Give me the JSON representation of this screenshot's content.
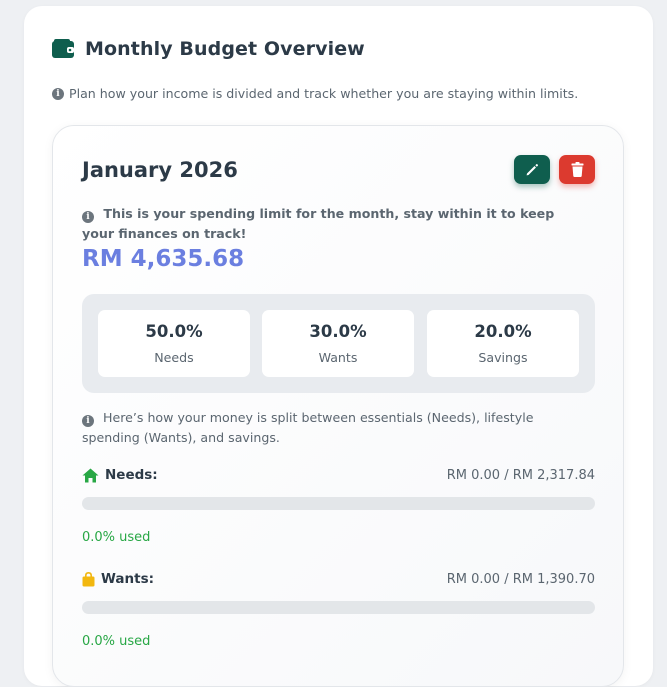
{
  "header": {
    "title": "Monthly Budget Overview",
    "info": "Plan how your income is divided and track whether you are staying within limits."
  },
  "budget": {
    "month": "January 2026",
    "limit_info": "This is your spending limit for the month, stay within it to keep your finances on track!",
    "amount": "RM 4,635.68",
    "split": [
      {
        "percent": "50.0%",
        "label": "Needs"
      },
      {
        "percent": "30.0%",
        "label": "Wants"
      },
      {
        "percent": "20.0%",
        "label": "Savings"
      }
    ],
    "split_info": "Here’s how your money is split between essentials (Needs), lifestyle spending (Wants), and savings.",
    "categories": [
      {
        "name": "Needs:",
        "amount": "RM 0.00 / RM 2,317.84",
        "used": "0.0% used",
        "used_fraction": 0,
        "icon": "home-icon"
      },
      {
        "name": "Wants:",
        "amount": "RM 0.00 / RM 1,390.70",
        "used": "0.0% used",
        "used_fraction": 0,
        "icon": "shopping-bag-icon"
      }
    ]
  },
  "colors": {
    "accent": "#6b7fe0",
    "edit": "#0f5e4e",
    "delete": "#dc3a2f",
    "success": "#28a745",
    "wants_icon": "#f2b70f"
  },
  "icons": [
    "wallet-icon",
    "info-icon",
    "pencil-icon",
    "trash-icon",
    "home-icon",
    "shopping-bag-icon"
  ]
}
